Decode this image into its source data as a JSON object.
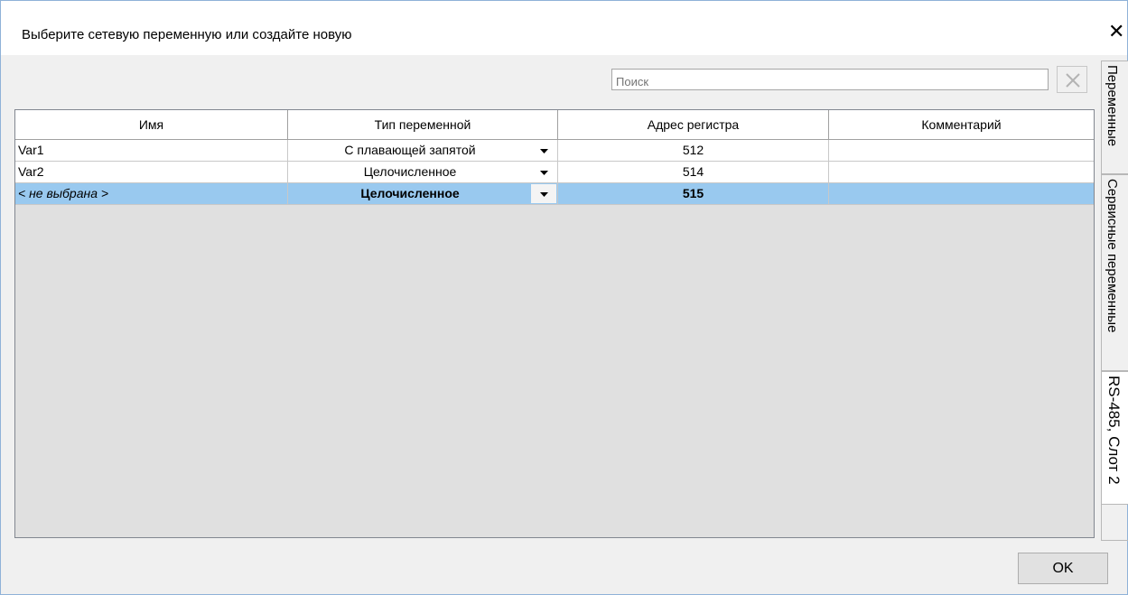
{
  "window": {
    "title": "Выберите сетевую переменную или создайте новую",
    "close_glyph": "✕"
  },
  "search": {
    "placeholder": "Поиск",
    "clear_icon": "close-icon"
  },
  "table": {
    "columns": [
      "Имя",
      "Тип переменной",
      "Адрес регистра",
      "Комментарий"
    ],
    "rows": [
      {
        "name": "Var1",
        "type": "С плавающей запятой",
        "address": "512",
        "comment": "",
        "selected": false
      },
      {
        "name": "Var2",
        "type": "Целочисленное",
        "address": "514",
        "comment": "",
        "selected": false
      },
      {
        "name": "< не выбрана >",
        "type": "Целочисленное",
        "address": "515",
        "comment": "",
        "selected": true
      }
    ]
  },
  "side_tabs": [
    {
      "label": "Переменные",
      "active": false
    },
    {
      "label": "Сервисные переменные",
      "active": false
    },
    {
      "label": "RS-485, Слот 2",
      "active": true
    }
  ],
  "footer": {
    "ok_label": "OK"
  },
  "colors": {
    "selection": "#99c9ef",
    "grid_empty": "#e0e0e0",
    "window_border": "#8fb2d8"
  }
}
